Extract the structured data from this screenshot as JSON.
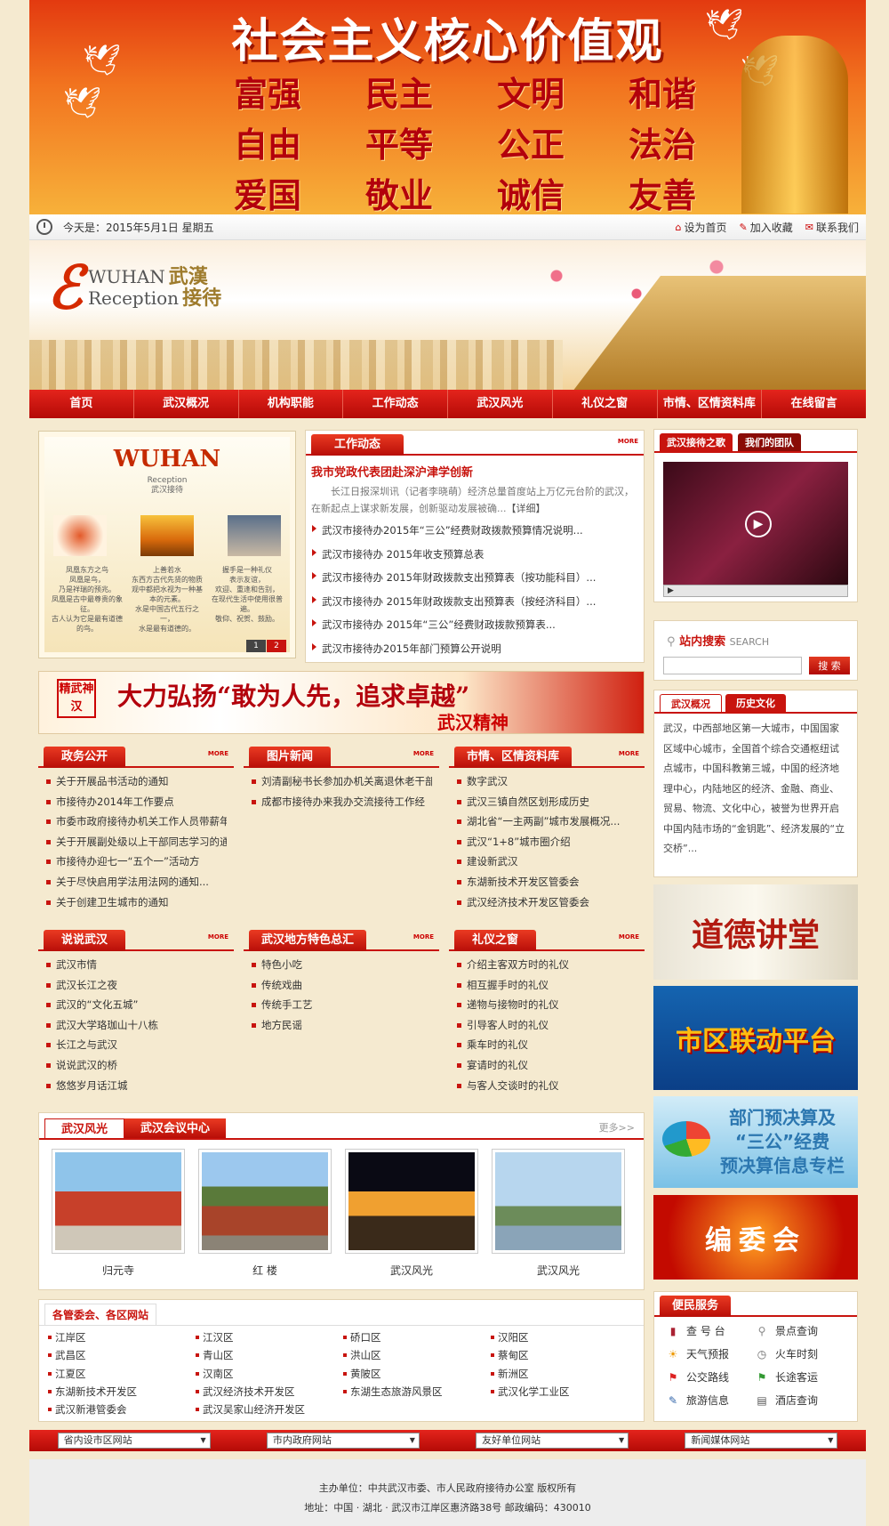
{
  "banner": {
    "slogan": "社会主义核心价值观",
    "values": [
      [
        "富强",
        "民主",
        "文明",
        "和谐"
      ],
      [
        "自由",
        "平等",
        "公正",
        "法治"
      ],
      [
        "爱国",
        "敬业",
        "诚信",
        "友善"
      ]
    ]
  },
  "datebar": {
    "today": "今天是：2015年5月1日  星期五",
    "links": [
      "设为首页",
      "加入收藏",
      "联系我们"
    ]
  },
  "header": {
    "logo_en1": "WUHAN",
    "logo_en2": "Reception",
    "logo_cn1": "武漢",
    "logo_cn2": "接待"
  },
  "nav": [
    "首页",
    "武汉概况",
    "机构职能",
    "工作动态",
    "武汉风光",
    "礼仪之窗",
    "市情、区情资料库",
    "在线留言"
  ],
  "picbox": {
    "logo": "WUHAN",
    "logo_sub": "Reception\n武汉接待",
    "captions": [
      "凤凰东方之鸟\n凤凰是鸟，\n乃是祥瑞的预兆。\n凤凰是古中最尊贵的象征。\n古人认为它是最有道德的鸟。",
      "上善若水\n东西方古代先贤的物质观中都把水视为一种基本的元素。\n水是中国古代五行之一，\n水是最有道德的。",
      "握手是一种礼仪\n表示友谊，\n欢迎、重逢和告别，\n在现代生活中使用很普遍。\n敬仰、祝贺、鼓励。"
    ],
    "pages": [
      "1",
      "2"
    ]
  },
  "news": {
    "title": "工作动态",
    "more": "MORE",
    "headline": "我市党政代表团赴深沪津学创新",
    "summary": "长江日报深圳讯（记者李晓萌）经济总量首度站上万亿元台阶的武汉，在新起点上谋求新发展，创新驱动发展被确...",
    "detail": "【详细】",
    "items": [
      "武汉市接待办2015年“三公”经费财政拨款预算情况说明...",
      "武汉市接待办 2015年收支预算总表",
      "武汉市接待办 2015年财政拨款支出预算表（按功能科目）...",
      "武汉市接待办 2015年财政拨款支出预算表（按经济科目）...",
      "武汉市接待办 2015年“三公”经费财政拨款预算表...",
      "武汉市接待办2015年部门预算公开说明"
    ]
  },
  "video": {
    "tab1": "武汉接待之歌",
    "tab2": "我们的团队"
  },
  "search": {
    "title": "站内搜索",
    "sub": "SEARCH",
    "placeholder": "",
    "button": "搜 索"
  },
  "overview": {
    "tab1": "武汉概况",
    "tab2": "历史文化",
    "text": "武汉，中西部地区第一大城市，中国国家区域中心城市，全国首个综合交通枢纽试点城市，中国科教第三城，中国的经济地理中心，内陆地区的经济、金融、商业、贸易、物流、文化中心，被誉为世界开启中国内陆市场的“金钥匙”、经济发展的“立交桥”..."
  },
  "ads": {
    "ad1": "道德讲堂",
    "ad2": "市区联动平台",
    "ad3_lines": [
      "部门预决算及",
      "“三公”经费",
      "预决算信息专栏"
    ],
    "ad4": "编委会"
  },
  "promo": {
    "stamp": "精武神汉",
    "main": "大力弘扬“敢为人先，追求卓越”",
    "sub": "武汉精神"
  },
  "sections": [
    {
      "title": "政务公开",
      "items": [
        "关于开展品书活动的通知",
        "市接待办2014年工作要点",
        "市委市政府接待办机关工作人员带薪年",
        "关于开展副处级以上干部同志学习的通",
        "市接待办迎七一“五个一”活动方",
        "关于尽快启用学法用法网的通知...",
        "关于创建卫生城市的通知"
      ]
    },
    {
      "title": "图片新闻",
      "items": [
        "刘清副秘书长参加办机关离退休老干部",
        "成都市接待办来我办交流接待工作经"
      ]
    },
    {
      "title": "市情、区情资料库",
      "items": [
        "数字武汉",
        "武汉三镇自然区划形成历史",
        "湖北省“一主两副”城市发展概况...",
        "武汉“1+8”城市圈介绍",
        "建设新武汉",
        "东湖新技术开发区管委会",
        "武汉经济技术开发区管委会"
      ]
    },
    {
      "title": "说说武汉",
      "items": [
        "武汉市情",
        "武汉长江之夜",
        "武汉的“文化五城”",
        "武汉大学珞珈山十八栋",
        "长江之与武汉",
        "说说武汉的桥",
        "悠悠岁月话江城"
      ]
    },
    {
      "title": "武汉地方特色总汇",
      "items": [
        "特色小吃",
        "传统戏曲",
        "传统手工艺",
        "地方民谣"
      ]
    },
    {
      "title": "礼仪之窗",
      "items": [
        "介绍主客双方时的礼仪",
        "相互握手时的礼仪",
        "递物与接物时的礼仪",
        "引导客人时的礼仪",
        "乘车时的礼仪",
        "宴请时的礼仪",
        "与客人交谈时的礼仪"
      ]
    }
  ],
  "section_more": "MORE",
  "gallery": {
    "tab1": "武汉风光",
    "tab2": "武汉会议中心",
    "more": "更多>>",
    "items": [
      "归元寺",
      "红  楼",
      "武汉风光",
      "武汉风光"
    ]
  },
  "districts": {
    "title": "各管委会、各区网站",
    "items": [
      "江岸区",
      "江汉区",
      "硚口区",
      "汉阳区",
      "武昌区",
      "青山区",
      "洪山区",
      "蔡甸区",
      "江夏区",
      "汉南区",
      "黄陂区",
      "新洲区",
      "东湖新技术开发区",
      "武汉经济技术开发区",
      "东湖生态旅游风景区",
      "武汉化学工业区",
      "武汉新港管委会",
      "武汉吴家山经济开发区"
    ]
  },
  "service": {
    "title": "便民服务",
    "items": [
      {
        "label": "查 号 台",
        "icon": "book-icon"
      },
      {
        "label": "景点查询",
        "icon": "magnifier-icon"
      },
      {
        "label": "天气预报",
        "icon": "weather-icon"
      },
      {
        "label": "火车时刻",
        "icon": "clock-icon"
      },
      {
        "label": "公交路线",
        "icon": "flag-icon"
      },
      {
        "label": "长途客运",
        "icon": "flag-green-icon"
      },
      {
        "label": "旅游信息",
        "icon": "pin-icon"
      },
      {
        "label": "酒店查询",
        "icon": "hotel-icon"
      }
    ]
  },
  "footer_selects": [
    "省内设市区网站",
    "市内政府网站",
    "友好单位网站",
    "新闻媒体网站"
  ],
  "footer": {
    "line1": "主办单位：中共武汉市委、市人民政府接待办公室  版权所有",
    "line2": "地址：中国 · 湖北 · 武汉市江岸区惠济路38号   邮政编码：430010"
  },
  "colors": {
    "brand_red": "#c8140e",
    "nav_red": "#e4241c"
  }
}
